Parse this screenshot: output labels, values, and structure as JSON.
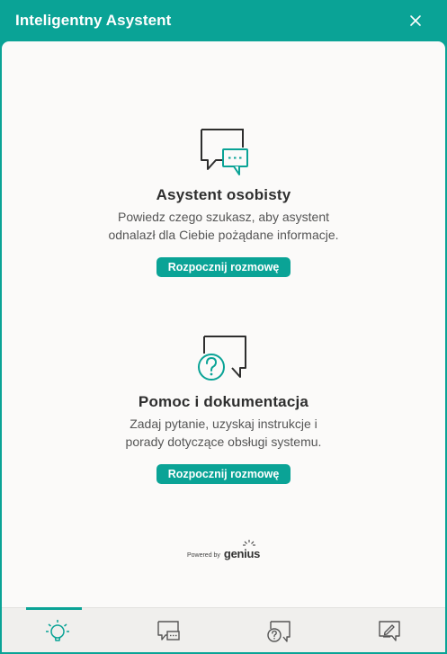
{
  "window": {
    "title": "Inteligentny Asystent"
  },
  "sections": [
    {
      "icon": "chat-bubbles-icon",
      "title": "Asystent osobisty",
      "description_lines": [
        "Powiedz czego szukasz, aby asystent",
        "odnalazł dla Ciebie pożądane informacje."
      ],
      "button_label": "Rozpocznij rozmowę"
    },
    {
      "icon": "help-question-icon",
      "title": "Pomoc i dokumentacja",
      "description_lines": [
        "Zadaj pytanie, uzyskaj instrukcje i",
        "porady dotyczące obsługi systemu."
      ],
      "button_label": "Rozpocznij rozmowę"
    }
  ],
  "powered_by": {
    "label": "Powered by",
    "brand": "genius"
  },
  "bottom_tabs": [
    {
      "icon": "lightbulb-icon",
      "active": true
    },
    {
      "icon": "chat-bubbles-icon",
      "active": false
    },
    {
      "icon": "help-question-icon",
      "active": false
    },
    {
      "icon": "edit-note-icon",
      "active": false
    }
  ],
  "colors": {
    "accent": "#0aa396",
    "panel_bg": "#fbfaf9",
    "text_dark": "#2e2e2e"
  }
}
